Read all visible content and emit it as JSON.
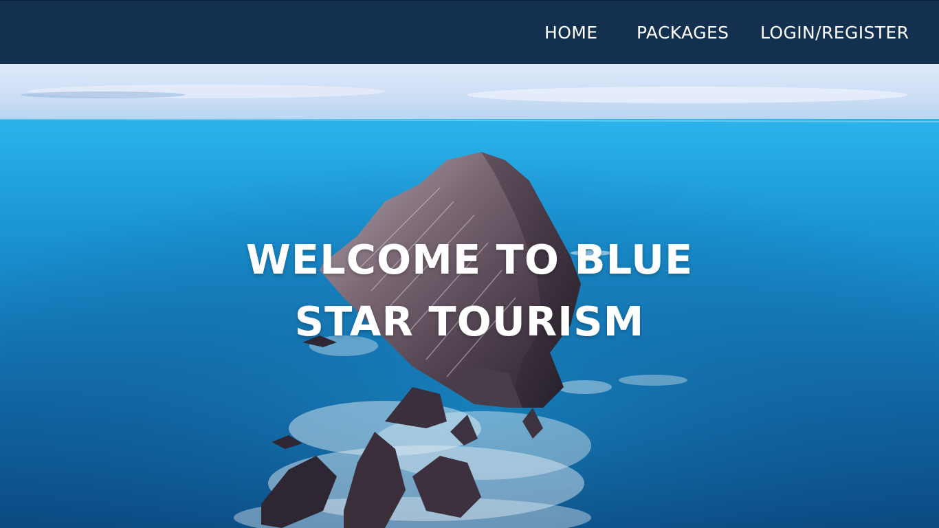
{
  "nav": {
    "items": [
      {
        "label": "HOME"
      },
      {
        "label": "PACKAGES"
      },
      {
        "label": "LOGIN/REGISTER"
      }
    ]
  },
  "hero": {
    "title_line1": "WELCOME TO BLUE",
    "title_line2": "STAR TOURISM",
    "image": "ocean-rock-aerial-photo"
  },
  "colors": {
    "navbar": "#13314f",
    "sky": "#cfe3f7",
    "ocean_light": "#1aa3e0",
    "ocean_deep": "#0e4f86",
    "title_text": "#ffffff"
  }
}
